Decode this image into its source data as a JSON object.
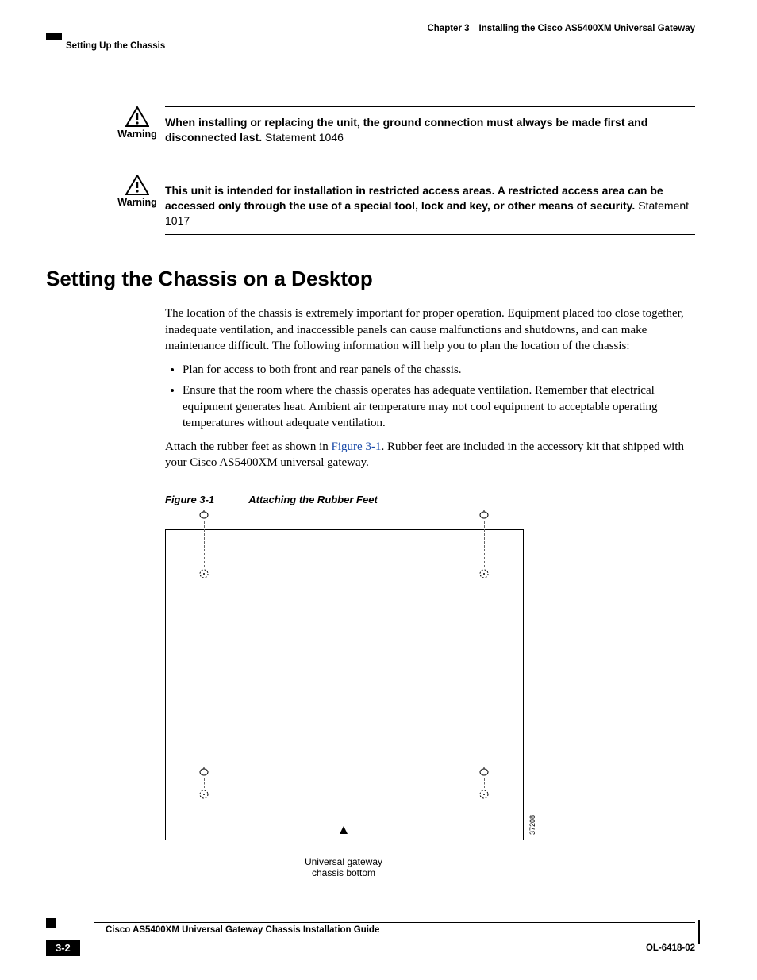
{
  "header": {
    "chapter_label": "Chapter 3",
    "chapter_title": "Installing the Cisco AS5400XM Universal Gateway",
    "section_name": "Setting Up the Chassis"
  },
  "warnings": [
    {
      "label": "Warning",
      "bold_text": "When installing or replacing the unit, the ground connection must always be made first and disconnected last.",
      "statement": "Statement 1046"
    },
    {
      "label": "Warning",
      "bold_text": "This unit is intended for installation in restricted access areas. A restricted access area can be accessed only through the use of a special tool, lock and key, or other means of security.",
      "statement": "Statement 1017"
    }
  ],
  "section": {
    "heading": "Setting the Chassis on a Desktop",
    "para1": "The location of the chassis is extremely important for proper operation. Equipment placed too close together, inadequate ventilation, and inaccessible panels can cause malfunctions and shutdowns, and can make maintenance difficult. The following information will help you to plan the location of the chassis:",
    "bullets": [
      "Plan for access to both front and rear panels of the chassis.",
      "Ensure that the room where the chassis operates has adequate ventilation. Remember that electrical equipment generates heat. Ambient air temperature may not cool equipment to acceptable operating temperatures without adequate ventilation."
    ],
    "para2_pre": "Attach the rubber feet as shown in ",
    "para2_link": "Figure 3-1",
    "para2_post": ". Rubber feet are included in the accessory kit that shipped with your Cisco AS5400XM universal gateway."
  },
  "figure": {
    "number": "Figure 3-1",
    "title": "Attaching the Rubber Feet",
    "callout_line1": "Universal gateway",
    "callout_line2": "chassis bottom",
    "image_id": "37208"
  },
  "footer": {
    "book_title": "Cisco AS5400XM Universal Gateway Chassis Installation Guide",
    "page_number": "3-2",
    "doc_id": "OL-6418-02"
  }
}
